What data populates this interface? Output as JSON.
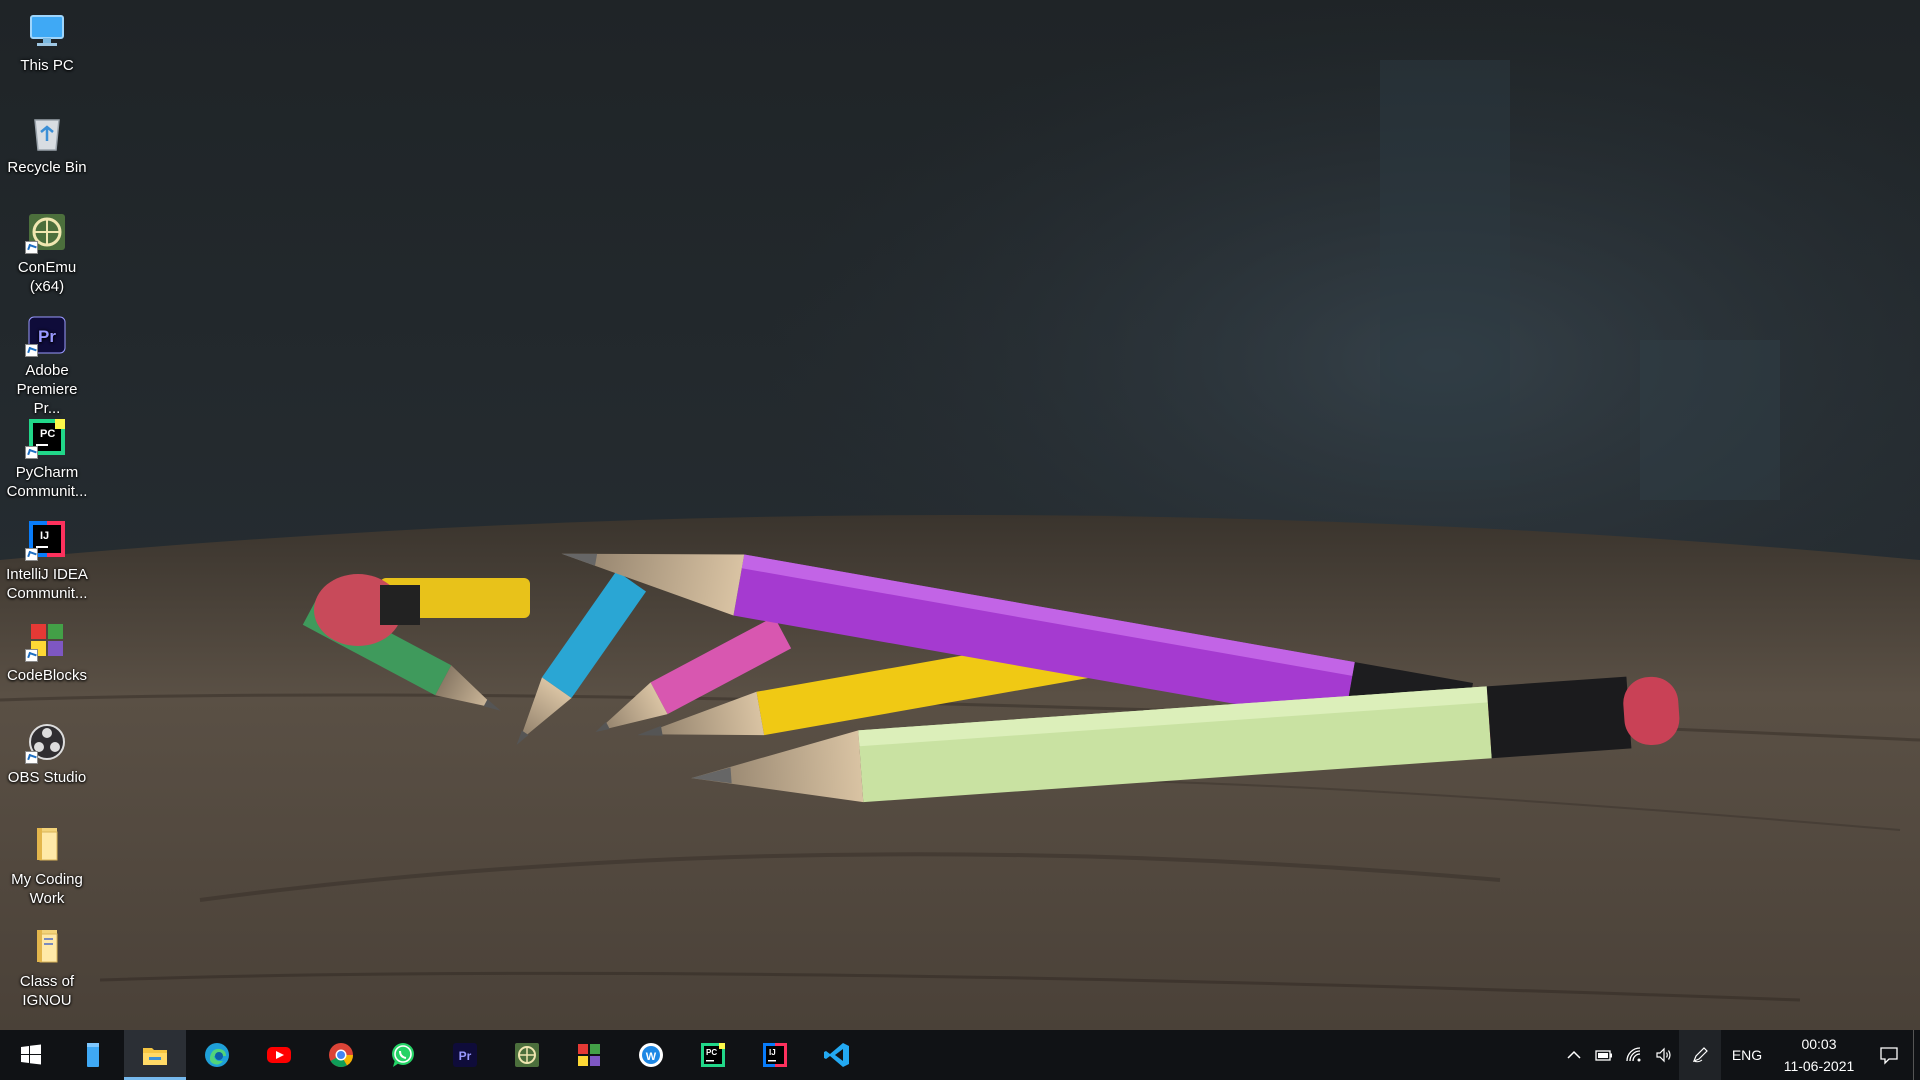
{
  "desktop_icons": [
    {
      "label": "This PC",
      "icon": "this-pc-icon"
    },
    {
      "label": "Recycle Bin",
      "icon": "recycle-bin-icon"
    },
    {
      "label": "ConEmu\n(x64)",
      "icon": "conemu-icon"
    },
    {
      "label": "Adobe\nPremiere Pr...",
      "icon": "premiere-pro-icon"
    },
    {
      "label": "PyCharm\nCommunit...",
      "icon": "pycharm-icon"
    },
    {
      "label": "IntelliJ IDEA\nCommunit...",
      "icon": "intellij-idea-icon"
    },
    {
      "label": "CodeBlocks",
      "icon": "codeblocks-icon"
    },
    {
      "label": "OBS Studio",
      "icon": "obs-studio-icon"
    },
    {
      "label": "My Coding\nWork",
      "icon": "folder-icon"
    },
    {
      "label": "Class of\nIGNOU",
      "icon": "folder-icon"
    }
  ],
  "taskbar": {
    "apps": [
      "start-icon",
      "notepad-icon",
      "file-explorer-icon",
      "edge-icon",
      "youtube-icon",
      "chrome-icon",
      "whatsapp-icon",
      "premiere-pro-icon",
      "conemu-icon",
      "codeblocks-icon",
      "app-w-icon",
      "pycharm-icon",
      "intellij-idea-icon",
      "vscode-icon"
    ],
    "active_app": "file-explorer-icon",
    "tray_icons": [
      "chevron-up-icon",
      "battery-icon",
      "wifi-icon",
      "volume-icon",
      "pen-icon"
    ],
    "language": "ENG",
    "time": "00:03",
    "date": "11-06-2021"
  },
  "colors": {
    "taskbar_bg": "#101215",
    "active_underline": "#76b9ed"
  }
}
